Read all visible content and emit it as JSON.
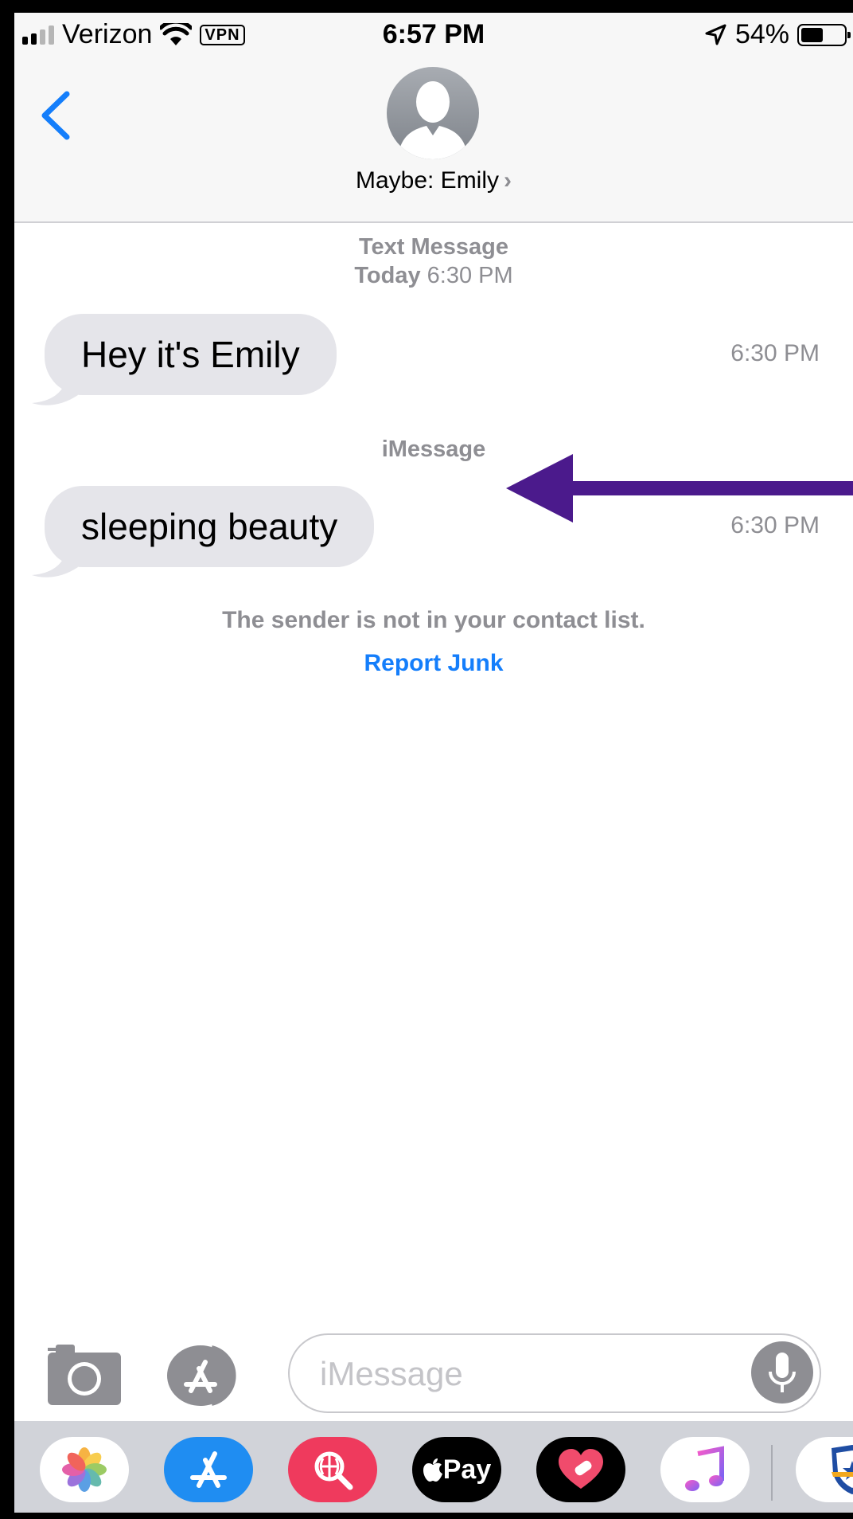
{
  "status_bar": {
    "carrier": "Verizon",
    "vpn": "VPN",
    "time": "6:57 PM",
    "battery": "54%",
    "battery_level": 0.54
  },
  "header": {
    "contact_name": "Maybe: Emily",
    "chevron": "›"
  },
  "conversation": {
    "sections": [
      {
        "service": "Text Message",
        "day": "Today",
        "time": "6:30 PM"
      },
      {
        "service": "iMessage"
      }
    ],
    "messages": [
      {
        "text": "Hey it's Emily",
        "time": "6:30 PM"
      },
      {
        "text": "sleeping beauty",
        "time": "6:30 PM"
      }
    ],
    "notice": "The sender is not in your contact list.",
    "report_junk": "Report Junk"
  },
  "input": {
    "placeholder": "iMessage"
  },
  "app_drawer": {
    "apps": [
      "photos-icon",
      "app-store-icon",
      "web-search-icon",
      "apple-pay-icon",
      "heart-sticker-icon",
      "music-icon",
      "espn-icon"
    ],
    "apple_pay_label": "Pay"
  },
  "colors": {
    "accent": "#147efb",
    "bubble": "#e5e5ea",
    "annotation_arrow": "#4b1a8c"
  }
}
